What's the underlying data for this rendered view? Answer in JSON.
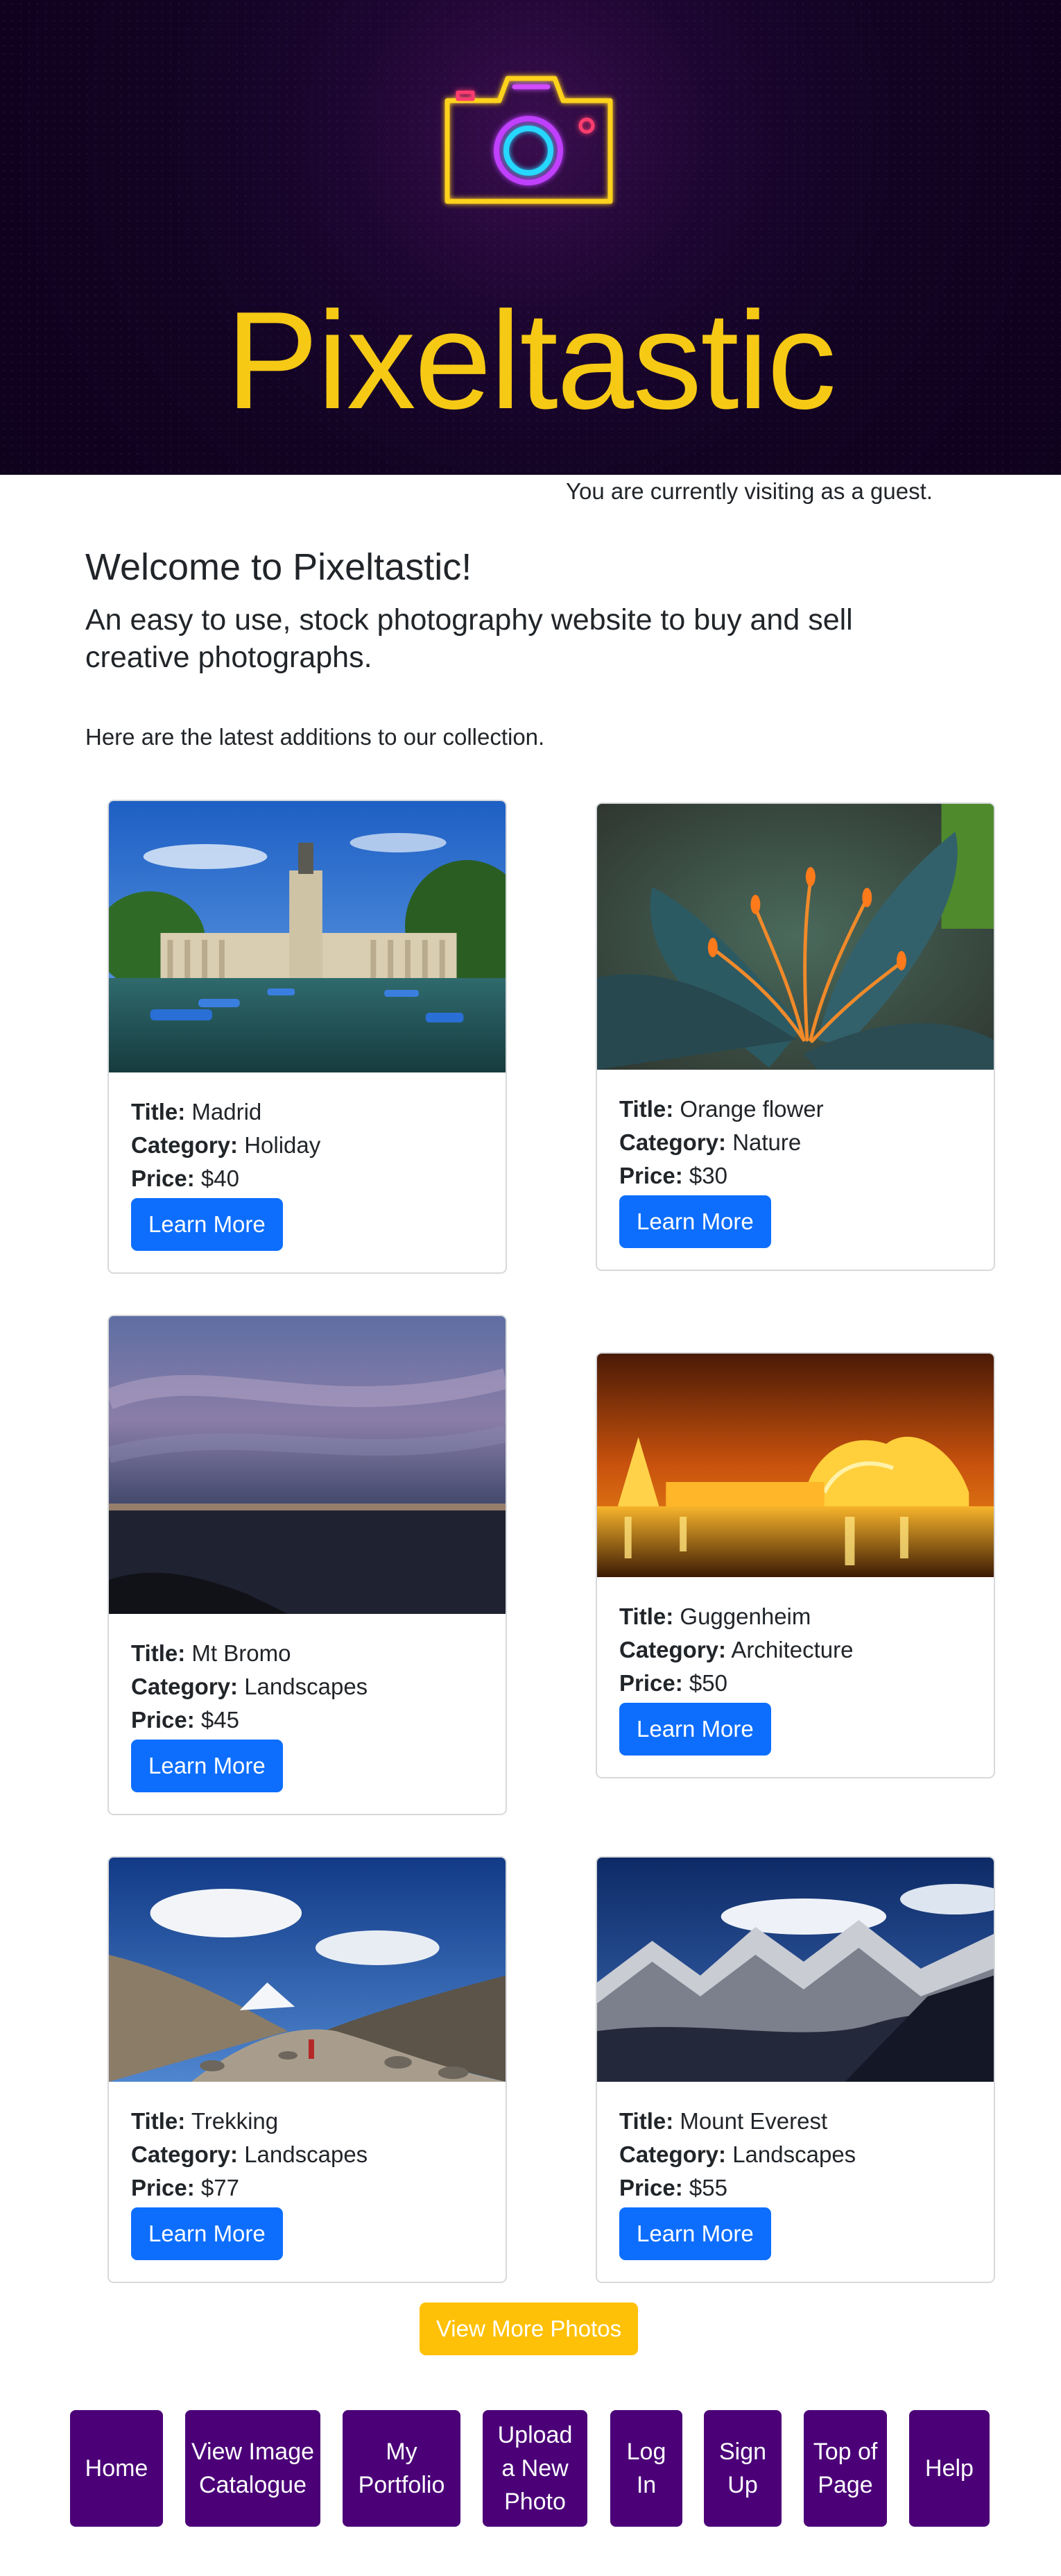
{
  "header": {
    "site_title": "Pixeltastic",
    "logo_icon": "neon-camera-icon",
    "colors": {
      "background": "#120322",
      "title": "#f6c915"
    }
  },
  "status": {
    "guest_message": "You are currently visiting as a guest."
  },
  "intro": {
    "welcome": "Welcome to Pixeltastic!",
    "tagline": "An easy to use, stock photography website to buy and sell creative photographs.",
    "latest": "Here are the latest additions to our collection."
  },
  "labels": {
    "title": "Title:",
    "category": "Category:",
    "price": "Price:"
  },
  "cards": [
    {
      "title": "Madrid",
      "category": "Holiday",
      "price": "$40",
      "button": "Learn More"
    },
    {
      "title": "Orange flower",
      "category": "Nature",
      "price": "$30",
      "button": "Learn More"
    },
    {
      "title": "Mt Bromo",
      "category": "Landscapes",
      "price": "$45",
      "button": "Learn More"
    },
    {
      "title": "Guggenheim",
      "category": "Architecture",
      "price": "$50",
      "button": "Learn More"
    },
    {
      "title": "Trekking",
      "category": "Landscapes",
      "price": "$77",
      "button": "Learn More"
    },
    {
      "title": "Mount Everest",
      "category": "Landscapes",
      "price": "$55",
      "button": "Learn More"
    }
  ],
  "view_more": "View More Photos",
  "footer_nav": [
    {
      "label": "Home"
    },
    {
      "label": "View Image Catalogue"
    },
    {
      "label": "My Portfolio"
    },
    {
      "label": "Upload a New Photo"
    },
    {
      "label": "Log In"
    },
    {
      "label": "Sign Up"
    },
    {
      "label": "Top of Page"
    },
    {
      "label": "Help"
    }
  ],
  "colors": {
    "primary": "#0d6efd",
    "warning": "#ffc107",
    "nav": "#4b0078"
  }
}
